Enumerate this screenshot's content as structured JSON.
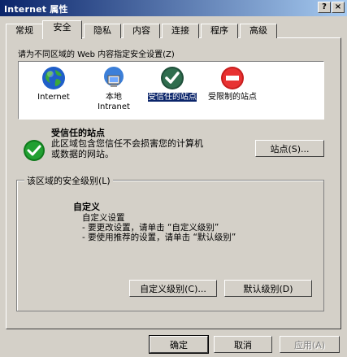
{
  "window": {
    "title": "Internet 属性",
    "help_button": "?",
    "close_button": "×"
  },
  "tabs": [
    "常规",
    "安全",
    "隐私",
    "内容",
    "连接",
    "程序",
    "高级"
  ],
  "zones_caption": "请为不同区域的 Web 内容指定安全设置(Z)",
  "zones": [
    {
      "label": "Internet"
    },
    {
      "label": "本地\nIntranet"
    },
    {
      "label": "受信任的站点"
    },
    {
      "label": "受限制的站点"
    }
  ],
  "zone_info": {
    "title": "受信任的站点",
    "description": "此区域包含您信任不会损害您的计算机或数据的网站。",
    "sites_button": "站点(S)..."
  },
  "security_level": {
    "group_title": "该区域的安全级别(L)",
    "heading": "自定义",
    "lines": [
      "自定义设置",
      "- 要更改设置，请单击 “自定义级别”",
      "- 要使用推荐的设置，请单击 “默认级别”"
    ],
    "custom_button": "自定义级别(C)...",
    "default_button": "默认级别(D)"
  },
  "footer": {
    "ok": "确定",
    "cancel": "取消",
    "apply": "应用(A)"
  }
}
